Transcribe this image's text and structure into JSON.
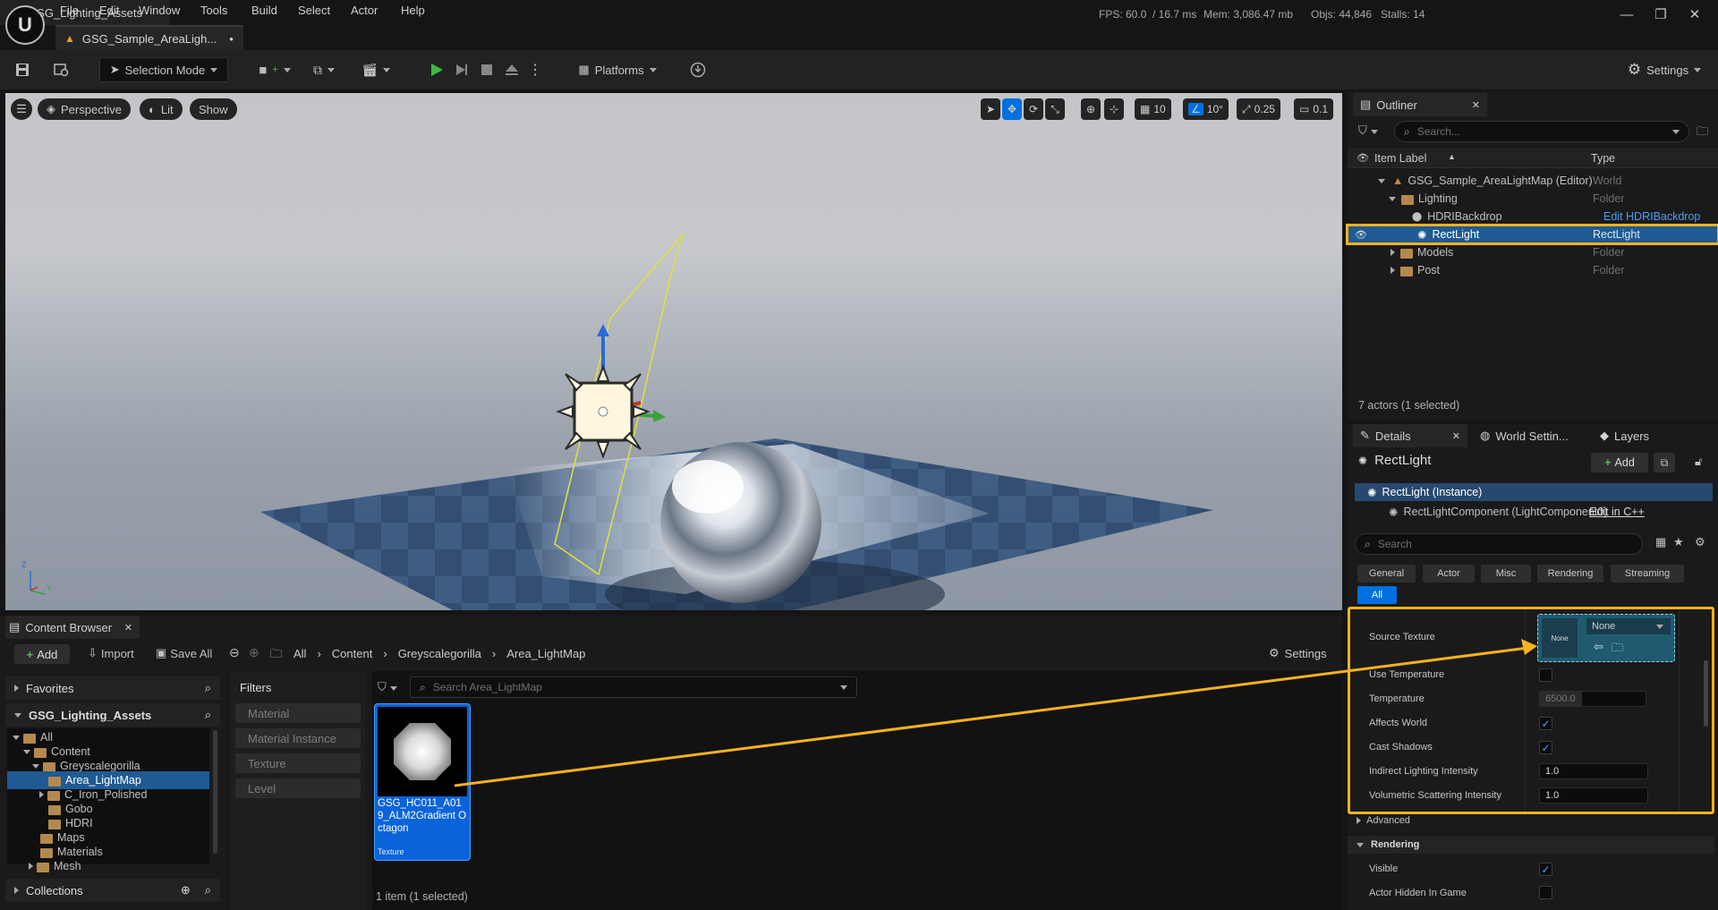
{
  "menu": {
    "items": [
      "File",
      "Edit",
      "Window",
      "Tools",
      "Build",
      "Select",
      "Actor",
      "Help"
    ]
  },
  "stats": {
    "fps": "FPS: 60.0",
    "frame_ms": "/ 16.7 ms",
    "mem": "Mem: 3,086.47 mb",
    "objs": "Objs: 44,846",
    "stalls": "Stalls: 14"
  },
  "project_name": "GSG_Lighting_Assets",
  "document_tab": {
    "label": "GSG_Sample_AreaLigh...",
    "dirty": "•"
  },
  "toolbar": {
    "selection_mode": "Selection Mode",
    "platforms": "Platforms",
    "settings": "Settings"
  },
  "viewport": {
    "perspective": "Perspective",
    "lit": "Lit",
    "show": "Show",
    "grid_snap": "10",
    "rotation_snap": "10°",
    "scale_snap": "0.25",
    "camera_speed": "0.1",
    "axis_x": "X",
    "axis_z": "Z",
    "axis_y": "Y"
  },
  "outliner": {
    "tab": "Outliner",
    "search_placeholder": "Search...",
    "col_label": "Item Label",
    "col_type": "Type",
    "rows": [
      {
        "label": "GSG_Sample_AreaLightMap (Editor)",
        "type": "World"
      },
      {
        "label": "Lighting",
        "type": "Folder"
      },
      {
        "label": "HDRIBackdrop",
        "type": "Edit HDRIBackdrop"
      },
      {
        "label": "RectLight",
        "type": "RectLight"
      },
      {
        "label": "Models",
        "type": "Folder"
      },
      {
        "label": "Post",
        "type": "Folder"
      }
    ],
    "footer": "7 actors (1 selected)"
  },
  "details": {
    "tabs": [
      "Details",
      "World Settin...",
      "Layers"
    ],
    "actor_name": "RectLight",
    "add_label": "Add",
    "instance_label": "RectLight (Instance)",
    "component_label": "RectLightComponent (LightComponent0)",
    "edit_cpp": "Edit in C++",
    "search_placeholder": "Search",
    "categories": [
      "General",
      "Actor",
      "Misc",
      "Rendering",
      "Streaming",
      "All"
    ],
    "active_category": "All",
    "props": {
      "source_texture": "Source Texture",
      "source_texture_value": "None",
      "thumb_none": "None",
      "use_temperature": "Use Temperature",
      "temperature": "Temperature",
      "temperature_value": "6500.0",
      "affects_world": "Affects World",
      "cast_shadows": "Cast Shadows",
      "indirect": "Indirect Lighting Intensity",
      "indirect_value": "1.0",
      "volumetric": "Volumetric Scattering Intensity",
      "volumetric_value": "1.0",
      "advanced": "Advanced",
      "rendering_section": "Rendering",
      "visible": "Visible",
      "hidden_in_game": "Actor Hidden In Game"
    }
  },
  "content_browser": {
    "tab": "Content Browser",
    "add": "Add",
    "import": "Import",
    "save_all": "Save All",
    "breadcrumb": [
      "All",
      "Content",
      "Greyscalegorilla",
      "Area_LightMap"
    ],
    "settings": "Settings",
    "favorites": "Favorites",
    "project": "GSG_Lighting_Assets",
    "tree": [
      "All",
      "Content",
      "Greyscalegorilla",
      "Area_LightMap",
      "C_Iron_Polished",
      "Gobo",
      "HDRI",
      "Maps",
      "Materials",
      "Mesh"
    ],
    "collections": "Collections",
    "filters_title": "Filters",
    "filters": [
      "Material",
      "Material Instance",
      "Texture",
      "Level"
    ],
    "search_placeholder": "Search Area_LightMap",
    "asset": {
      "name": "GSG_HC011_A019_ALM2Gradient Octagon",
      "type": "Texture"
    },
    "footer": "1 item (1 selected)"
  },
  "colors": {
    "accent": "#0070e0",
    "highlight": "#f5b21d",
    "selected_row": "#1f5a94",
    "play_green": "#3fb93f"
  }
}
